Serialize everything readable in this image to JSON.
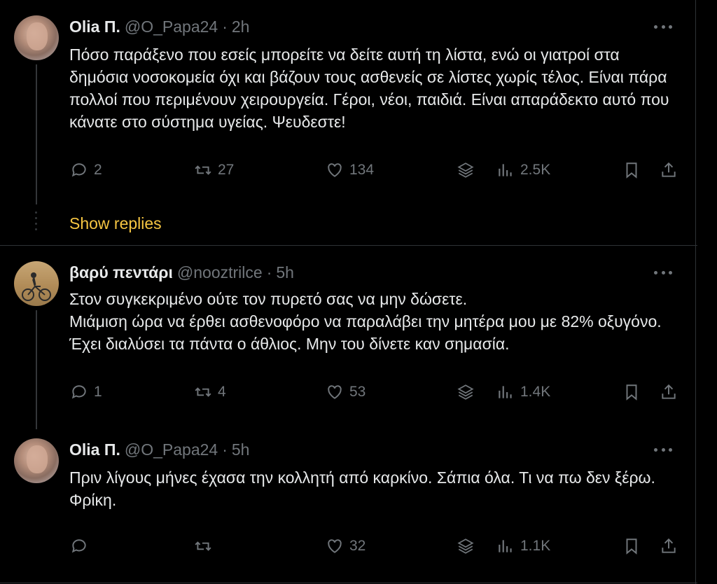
{
  "colors": {
    "background": "#000000",
    "text": "#e7e9ea",
    "muted": "#71767b",
    "accent": "#f5c542",
    "border": "#2f3336"
  },
  "tweets": [
    {
      "name": "Olia Π.",
      "handle": "@O_Papa24",
      "time": "2h",
      "separator": "·",
      "text": "Πόσο παράξενο που εσείς μπορείτε να δείτε αυτή τη λίστα, ενώ οι γιατροί στα δημόσια νοσοκομεία όχι και βάζουν τους ασθενείς σε λίστες χωρίς τέλος. Είναι πάρα πολλοί που περιμένουν χειρουργεία. Γέροι, νέοι, παιδιά. Είναι απαράδεκτο αυτό που κάνατε στο σύστημα υγείας. Ψευδεστε!",
      "replies": "2",
      "reposts": "27",
      "likes": "134",
      "views": "2.5K"
    },
    {
      "name": "βαρύ πεντάρι",
      "handle": "@nooztrilce",
      "time": "5h",
      "separator": "·",
      "text_lines": [
        "Στον συγκεκριμένο ούτε τον πυρετό σας να μην δώσετε.",
        "Μιάμιση ώρα να έρθει ασθενοφόρο να παραλάβει την μητέρα μου με 82% οξυγόνο. Έχει διαλύσει τα πάντα ο άθλιος. Μην του δίνετε καν σημασία."
      ],
      "replies": "1",
      "reposts": "4",
      "likes": "53",
      "views": "1.4K"
    },
    {
      "name": "Olia Π.",
      "handle": "@O_Papa24",
      "time": "5h",
      "separator": "·",
      "text": "Πριν λίγους μήνες έχασα την κολλητή από καρκίνο. Σάπια όλα. Τι να πω δεν ξέρω. Φρίκη.",
      "replies": "",
      "reposts": "",
      "likes": "32",
      "views": "1.1K"
    }
  ],
  "show_replies_label": "Show replies",
  "icons": [
    "reply-icon",
    "repost-icon",
    "like-icon",
    "grok-stack-icon",
    "views-icon",
    "bookmark-icon",
    "share-icon",
    "more-icon"
  ]
}
